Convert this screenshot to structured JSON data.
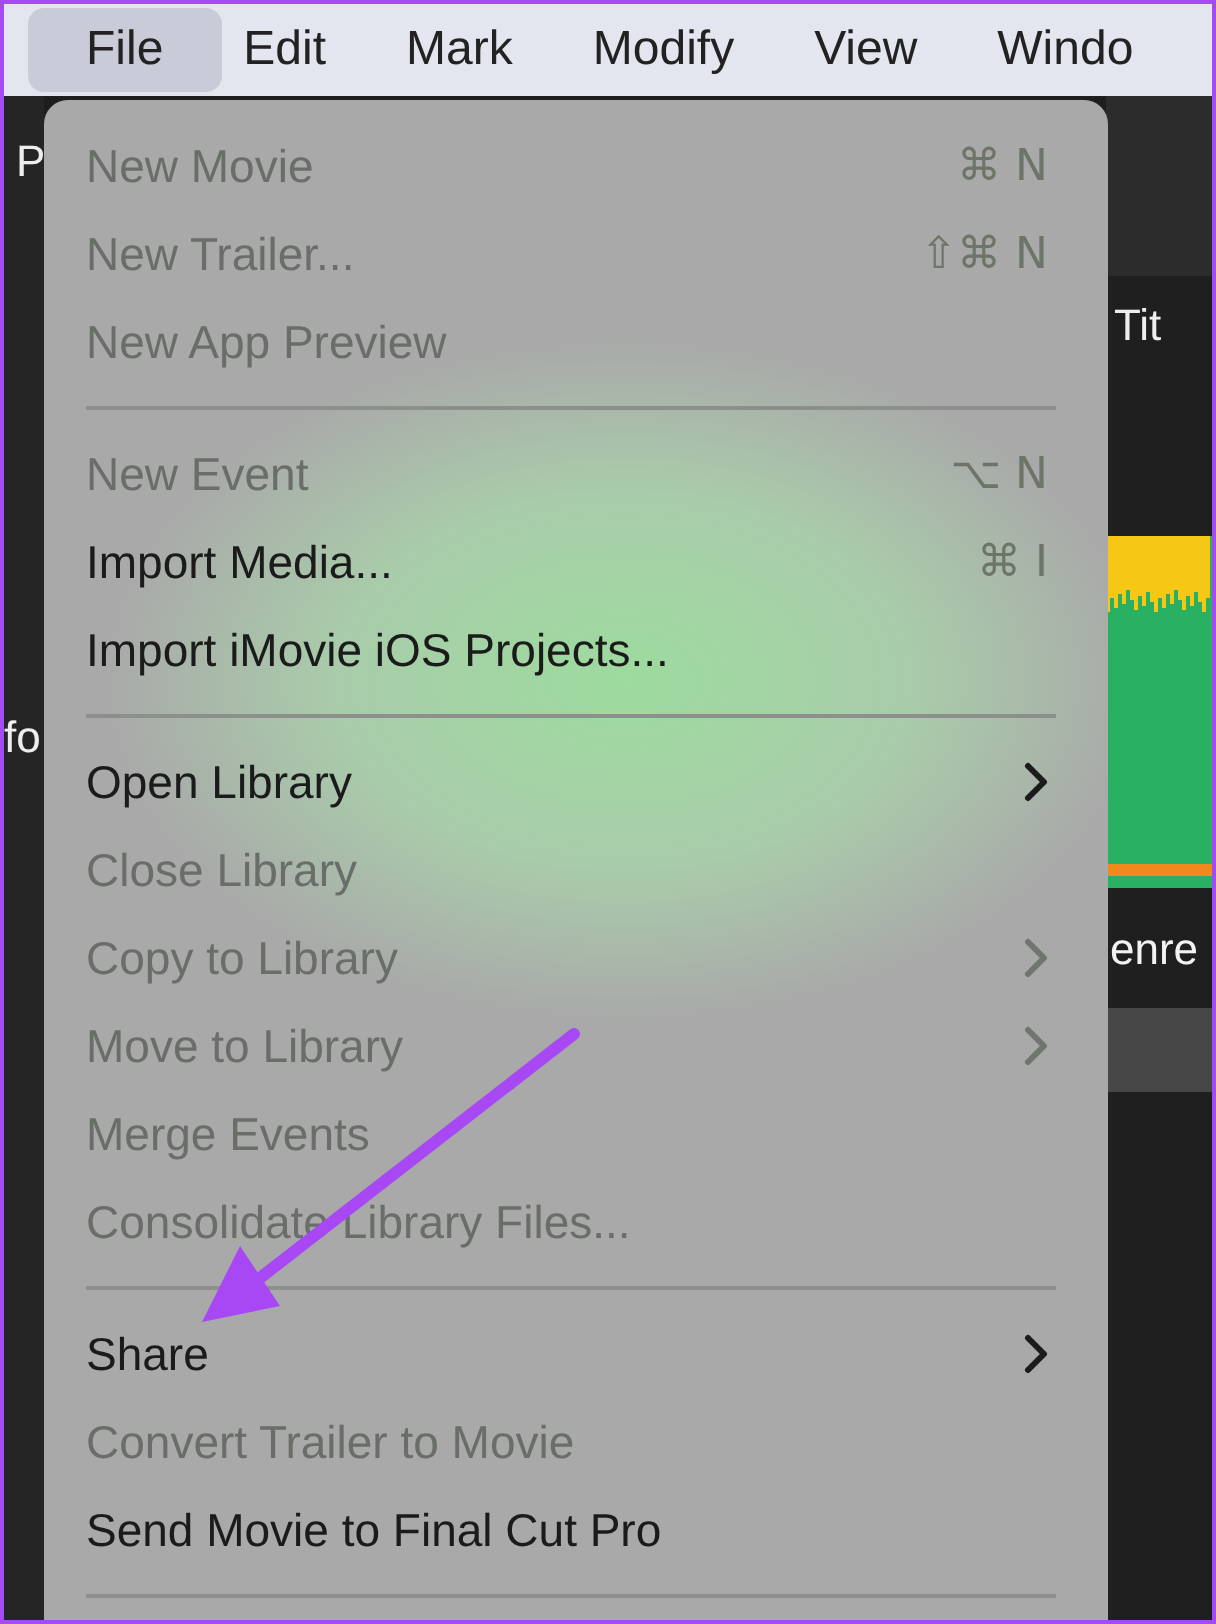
{
  "menubar": [
    {
      "label": "File",
      "selected": true
    },
    {
      "label": "Edit",
      "selected": false
    },
    {
      "label": "Mark",
      "selected": false
    },
    {
      "label": "Modify",
      "selected": false
    },
    {
      "label": "View",
      "selected": false
    },
    {
      "label": "Windo",
      "selected": false
    }
  ],
  "app_behind": {
    "left_labels": [
      "P",
      "fo"
    ],
    "title_button": "Tit",
    "genre_label": "enre"
  },
  "menu": {
    "items": [
      {
        "kind": "item",
        "label": "New Movie",
        "shortcut": "⌘ N",
        "disabled": true
      },
      {
        "kind": "item",
        "label": "New Trailer...",
        "shortcut": "⇧⌘ N",
        "disabled": true
      },
      {
        "kind": "item",
        "label": "New App Preview",
        "disabled": true
      },
      {
        "kind": "separator"
      },
      {
        "kind": "item",
        "label": "New Event",
        "shortcut": "⌥ N",
        "disabled": true
      },
      {
        "kind": "item",
        "label": "Import Media...",
        "shortcut": "⌘ I",
        "disabled": false
      },
      {
        "kind": "item",
        "label": "Import iMovie iOS Projects...",
        "disabled": false
      },
      {
        "kind": "separator"
      },
      {
        "kind": "item",
        "label": "Open Library",
        "submenu": true,
        "disabled": false
      },
      {
        "kind": "item",
        "label": "Close Library",
        "disabled": true
      },
      {
        "kind": "item",
        "label": "Copy to Library",
        "submenu": true,
        "disabled": true
      },
      {
        "kind": "item",
        "label": "Move to Library",
        "submenu": true,
        "disabled": true
      },
      {
        "kind": "item",
        "label": "Merge Events",
        "disabled": true
      },
      {
        "kind": "item",
        "label": "Consolidate Library Files...",
        "disabled": true
      },
      {
        "kind": "separator"
      },
      {
        "kind": "item",
        "label": "Share",
        "submenu": true,
        "disabled": false
      },
      {
        "kind": "item",
        "label": "Convert Trailer to Movie",
        "disabled": true
      },
      {
        "kind": "item",
        "label": "Send Movie to Final Cut Pro",
        "disabled": false
      },
      {
        "kind": "separator"
      }
    ]
  }
}
